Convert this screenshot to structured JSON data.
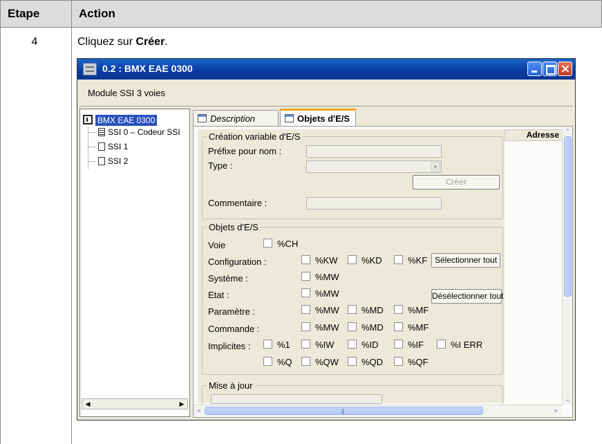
{
  "doc": {
    "headers": {
      "step": "Etape",
      "action": "Action"
    },
    "step_number": "4",
    "instruction_prefix": "Cliquez sur ",
    "instruction_bold": "Créer",
    "instruction_suffix": "."
  },
  "window": {
    "title": "0.2 : BMX  EAE 0300",
    "module_description": "Module SSI 3 voies",
    "controls": [
      "minimize-icon",
      "maximize-icon",
      "close-icon"
    ]
  },
  "tree": {
    "root": "BMX EAE 0300",
    "children": [
      "SSI 0 – Codeur SSI",
      "SSI 1",
      "SSI 2"
    ]
  },
  "tabs": [
    {
      "label": "Description",
      "active": false
    },
    {
      "label": "Objets d'E/S",
      "active": true
    }
  ],
  "creation": {
    "legend": "Création variable d'E/S",
    "prefix_label": "Préfixe pour nom :",
    "prefix_value": "",
    "type_label": "Type :",
    "type_value": "",
    "create_button": "Créer",
    "comment_label": "Commentaire :",
    "comment_value": ""
  },
  "objects": {
    "legend": "Objets d'E/S",
    "rows": {
      "voie": {
        "label": "Voie",
        "boxes": [
          "%CH"
        ]
      },
      "configuration": {
        "label": "Configuration :",
        "boxes": [
          "%KW",
          "%KD",
          "%KF"
        ]
      },
      "systeme": {
        "label": "Système :",
        "boxes": [
          "%MW"
        ]
      },
      "etat": {
        "label": "Etat :",
        "boxes": [
          "%MW"
        ]
      },
      "parametre": {
        "label": "Paramètre :",
        "boxes": [
          "%MW",
          "%MD",
          "%MF"
        ]
      },
      "commande": {
        "label": "Commande :",
        "boxes": [
          "%MW",
          "%MD",
          "%MF"
        ]
      },
      "implicites": {
        "label": "Implicites :",
        "boxes": [
          "%1",
          "%IW",
          "%ID",
          "%IF",
          "%I ERR",
          "%Q",
          "%QW",
          "%QD",
          "%QF"
        ]
      }
    },
    "select_all": "Sélectionner tout",
    "deselect_all": "Désélectionner tout"
  },
  "update": {
    "legend": "Mise à jour"
  },
  "table_header": {
    "address": "Adresse"
  }
}
